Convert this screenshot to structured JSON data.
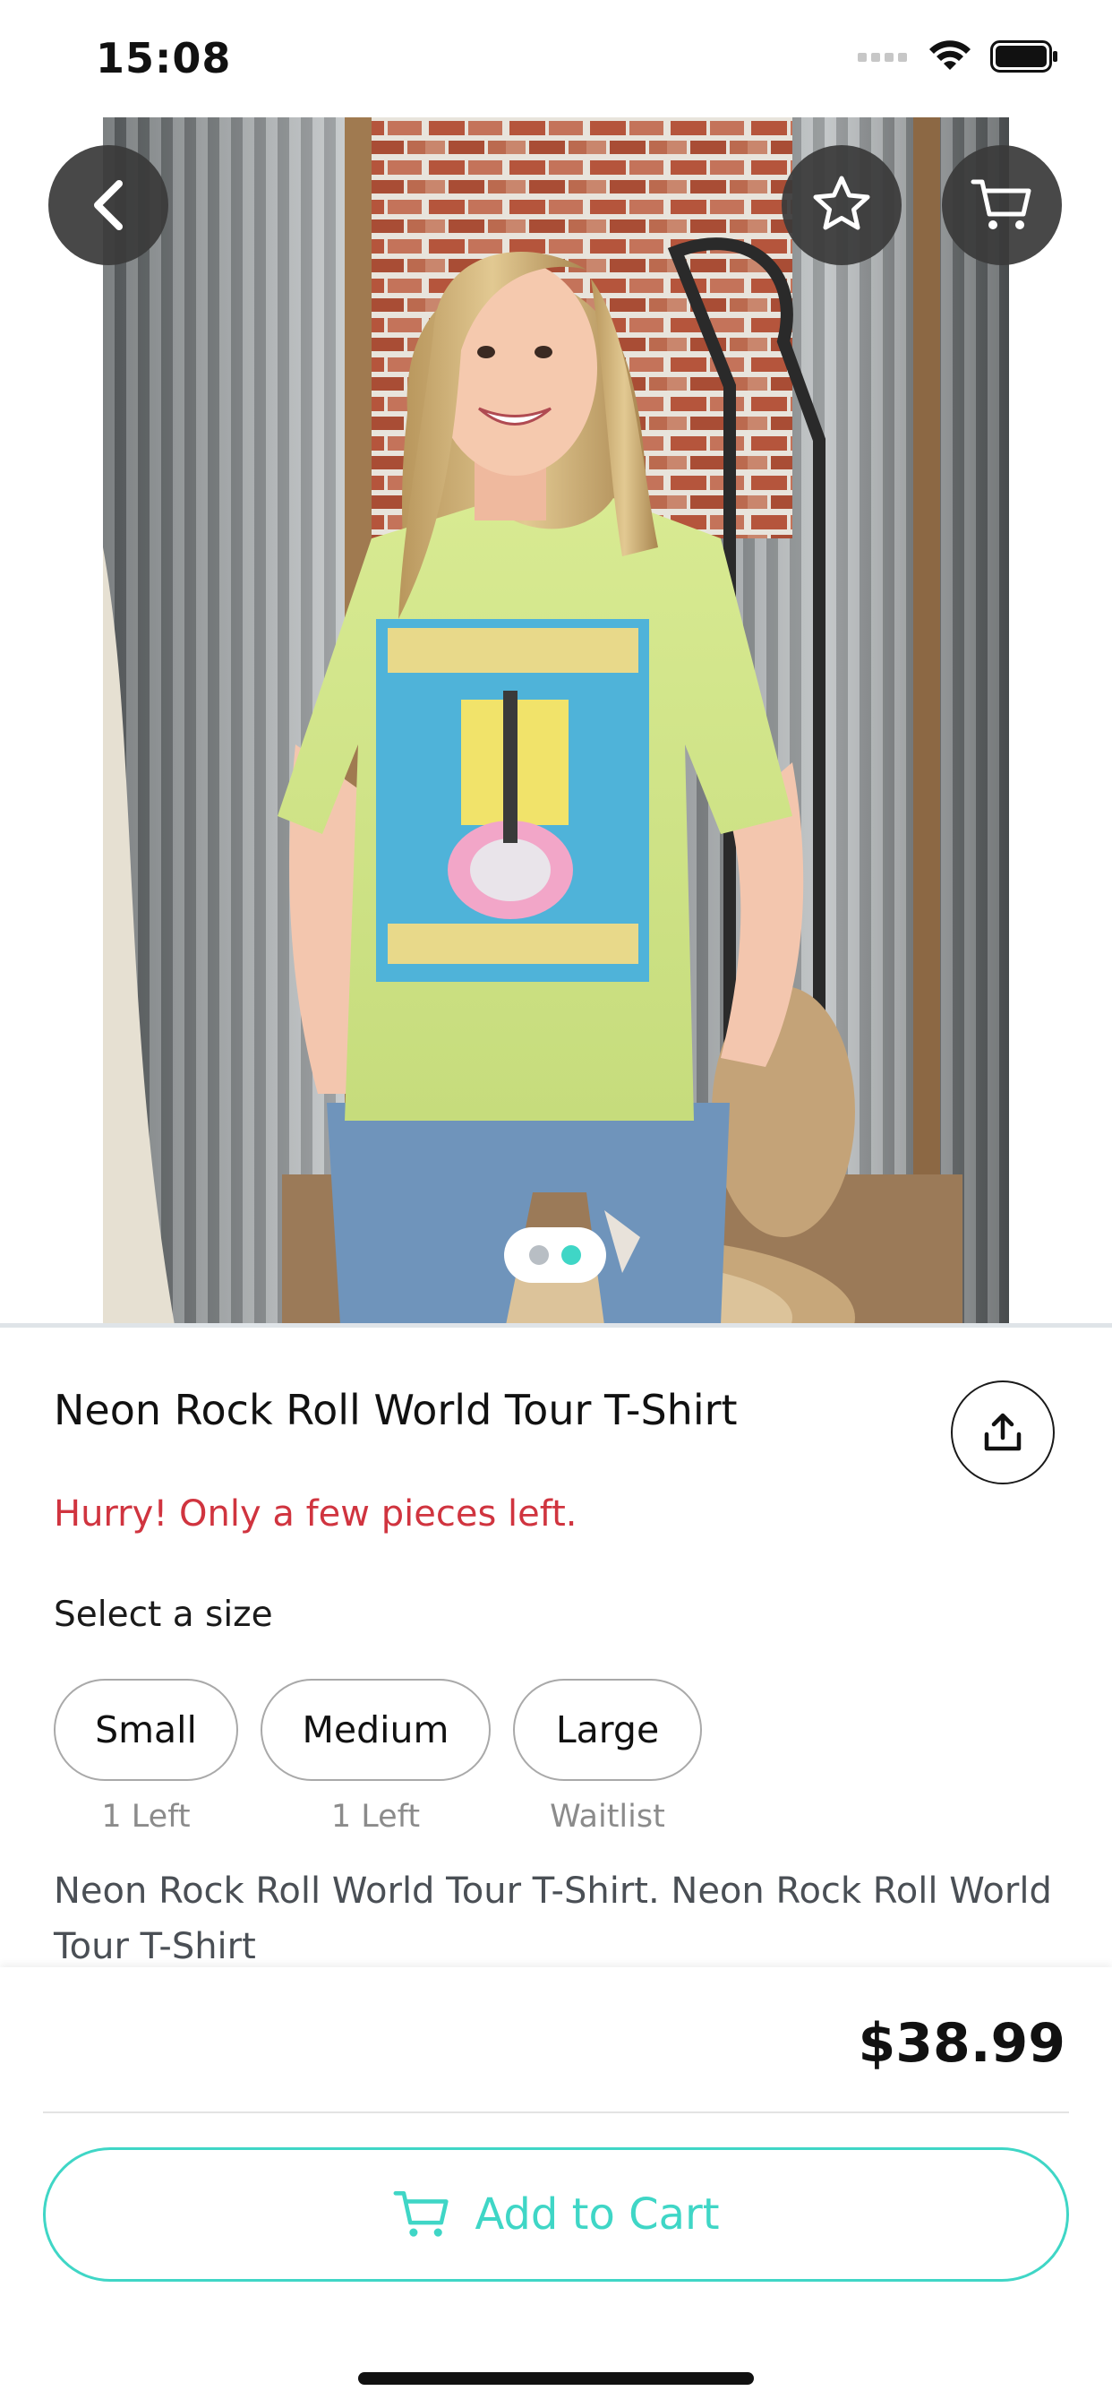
{
  "status_bar": {
    "time": "15:08"
  },
  "gallery": {
    "pages": 2,
    "active_page": 2,
    "active_color": "#3fd6c6",
    "inactive_color": "#b8bec4"
  },
  "nav": {
    "back_icon": "chevron-left-icon",
    "favorite_icon": "star-icon",
    "cart_icon": "cart-icon"
  },
  "product": {
    "title": "Neon Rock Roll World Tour T-Shirt",
    "stock_warning": "Hurry! Only a few pieces left.",
    "size_prompt": "Select a size",
    "sizes": [
      {
        "label": "Small",
        "availability": "1 Left"
      },
      {
        "label": "Medium",
        "availability": "1 Left"
      },
      {
        "label": "Large",
        "availability": "Waitlist"
      }
    ],
    "description": "Neon Rock Roll World Tour T-Shirt. Neon Rock Roll World Tour T-Shirt",
    "price": "$38.99"
  },
  "cart_button": {
    "label": "Add to Cart",
    "icon": "cart-icon"
  },
  "colors": {
    "accent": "#3fd6c6",
    "warning": "#d0343f"
  }
}
